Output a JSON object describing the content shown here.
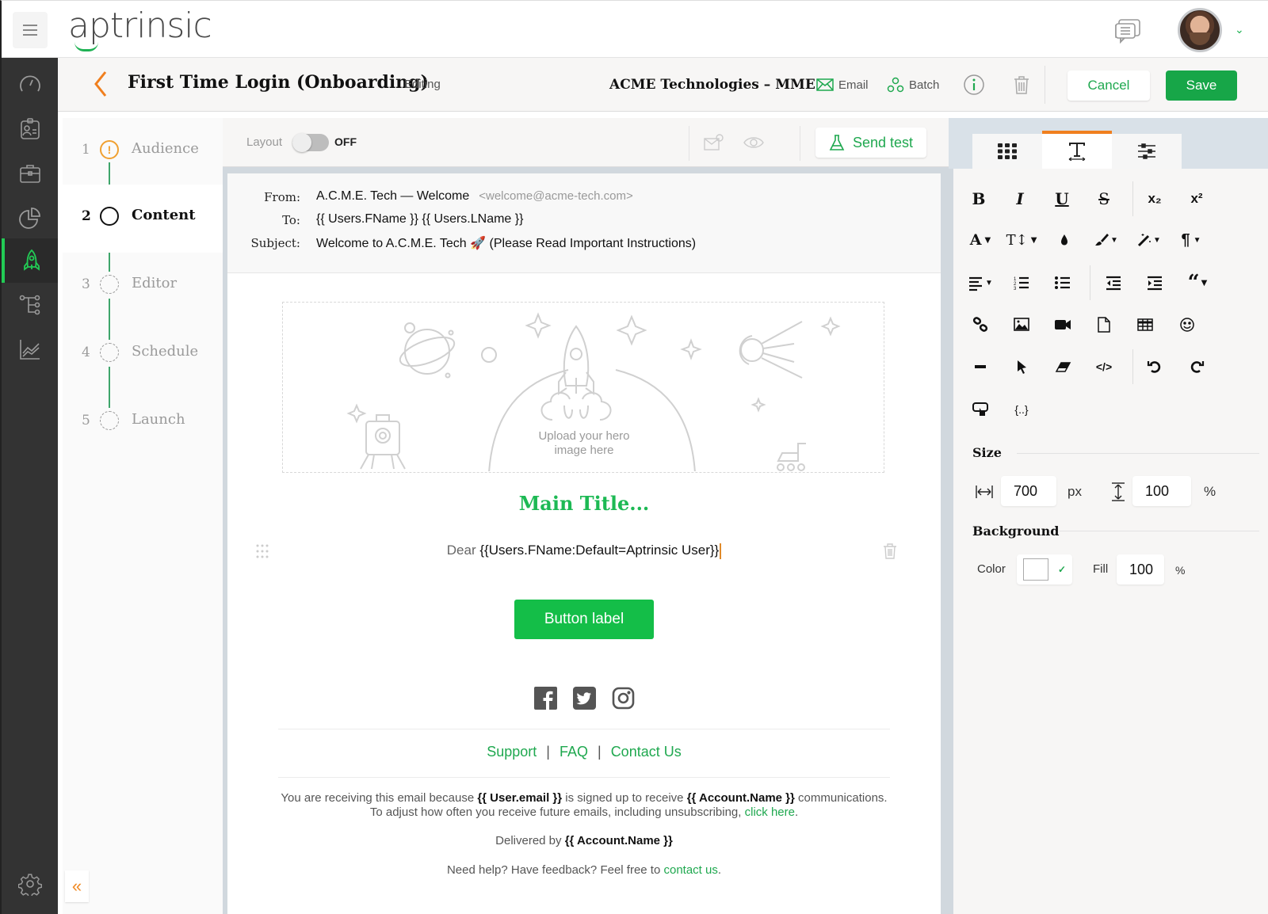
{
  "app": {
    "logo": "aptrinsic",
    "menu_icon": "hamburger-icon",
    "chat_icon": "chat-icon",
    "avatar_icon": "user-avatar"
  },
  "left_nav": {
    "items": [
      {
        "icon": "dashboard-gauge-icon",
        "active": false
      },
      {
        "icon": "contacts-card-icon",
        "active": false
      },
      {
        "icon": "briefcase-icon",
        "active": false
      },
      {
        "icon": "pie-chart-icon",
        "active": false
      },
      {
        "icon": "rocket-icon",
        "active": true
      },
      {
        "icon": "tree-flow-icon",
        "active": false
      },
      {
        "icon": "analytics-chart-icon",
        "active": false
      }
    ],
    "settings_icon": "gear-icon"
  },
  "header": {
    "title": "First Time Login (Onboarding)",
    "status": "Editing",
    "account": "ACME Technologies – MME",
    "email_label": "Email",
    "batch_label": "Batch",
    "cancel_label": "Cancel",
    "save_label": "Save"
  },
  "steps": [
    {
      "num": "1",
      "label": "Audience",
      "state": "warning"
    },
    {
      "num": "2",
      "label": "Content",
      "state": "active"
    },
    {
      "num": "3",
      "label": "Editor",
      "state": "pending"
    },
    {
      "num": "4",
      "label": "Schedule",
      "state": "pending"
    },
    {
      "num": "5",
      "label": "Launch",
      "state": "pending"
    }
  ],
  "collapse_label": "«",
  "toolbar": {
    "layout_label": "Layout",
    "layout_state": "OFF",
    "send_test_label": "Send test"
  },
  "email": {
    "from_label": "From:",
    "from_name": "A.C.M.E. Tech — Welcome",
    "from_address": "<welcome@acme-tech.com>",
    "to_label": "To:",
    "to_value": "{{ Users.FName }} {{ Users.LName }}",
    "subject_label": "Subject:",
    "subject_value": "Welcome to A.C.M.E. Tech 🚀 (Please Read Important Instructions)",
    "hero_placeholder_line1": "Upload your hero",
    "hero_placeholder_line2": "image here",
    "main_title": "Main Title...",
    "dear_prefix": "Dear",
    "dear_token": "{{Users.FName:Default=Aptrinsic User}}",
    "button_label": "Button label",
    "social": [
      "facebook-icon",
      "twitter-icon",
      "instagram-icon"
    ],
    "footer_links": [
      "Support",
      "FAQ",
      "Contact Us"
    ],
    "footer_sep": "|",
    "notice": {
      "p1": "You are receiving this email because",
      "t1": "{{ User.email }}",
      "p2": "is signed up to receive",
      "t2": "{{ Account.Name }}",
      "p3": "communications.",
      "line2": "To adjust how often you receive future emails, including unsubscribing,",
      "link": "click here",
      "end": "."
    },
    "delivered_prefix": "Delivered by",
    "delivered_token": "{{ Account.Name }}",
    "help_text": "Need help? Have feedback? Feel free to",
    "help_link": "contact us",
    "help_end": "."
  },
  "props": {
    "tabs": [
      {
        "icon": "blocks-grid-icon",
        "active": false
      },
      {
        "icon": "text-format-icon",
        "active": true
      },
      {
        "icon": "settings-sliders-icon",
        "active": false
      }
    ],
    "tools": {
      "row1": [
        "B",
        "I",
        "U",
        "S",
        "x₂",
        "x²"
      ],
      "row2": [
        "A ▾",
        "T↕ ▾",
        "💧",
        "brush ▾",
        "wand ▾",
        "¶ ▾"
      ],
      "subscript": "x₂",
      "superscript": "x²"
    },
    "size_title": "Size",
    "width_value": "700",
    "width_unit": "px",
    "height_value": "100",
    "height_unit": "%",
    "background_title": "Background",
    "color_label": "Color",
    "color_value": "#ffffff",
    "fill_label": "Fill",
    "fill_value": "100",
    "fill_unit": "%"
  },
  "colors": {
    "brand_green": "#1db954",
    "save_green": "#17a648",
    "accent_orange": "#f07f1e",
    "nav_dark": "#333333"
  }
}
